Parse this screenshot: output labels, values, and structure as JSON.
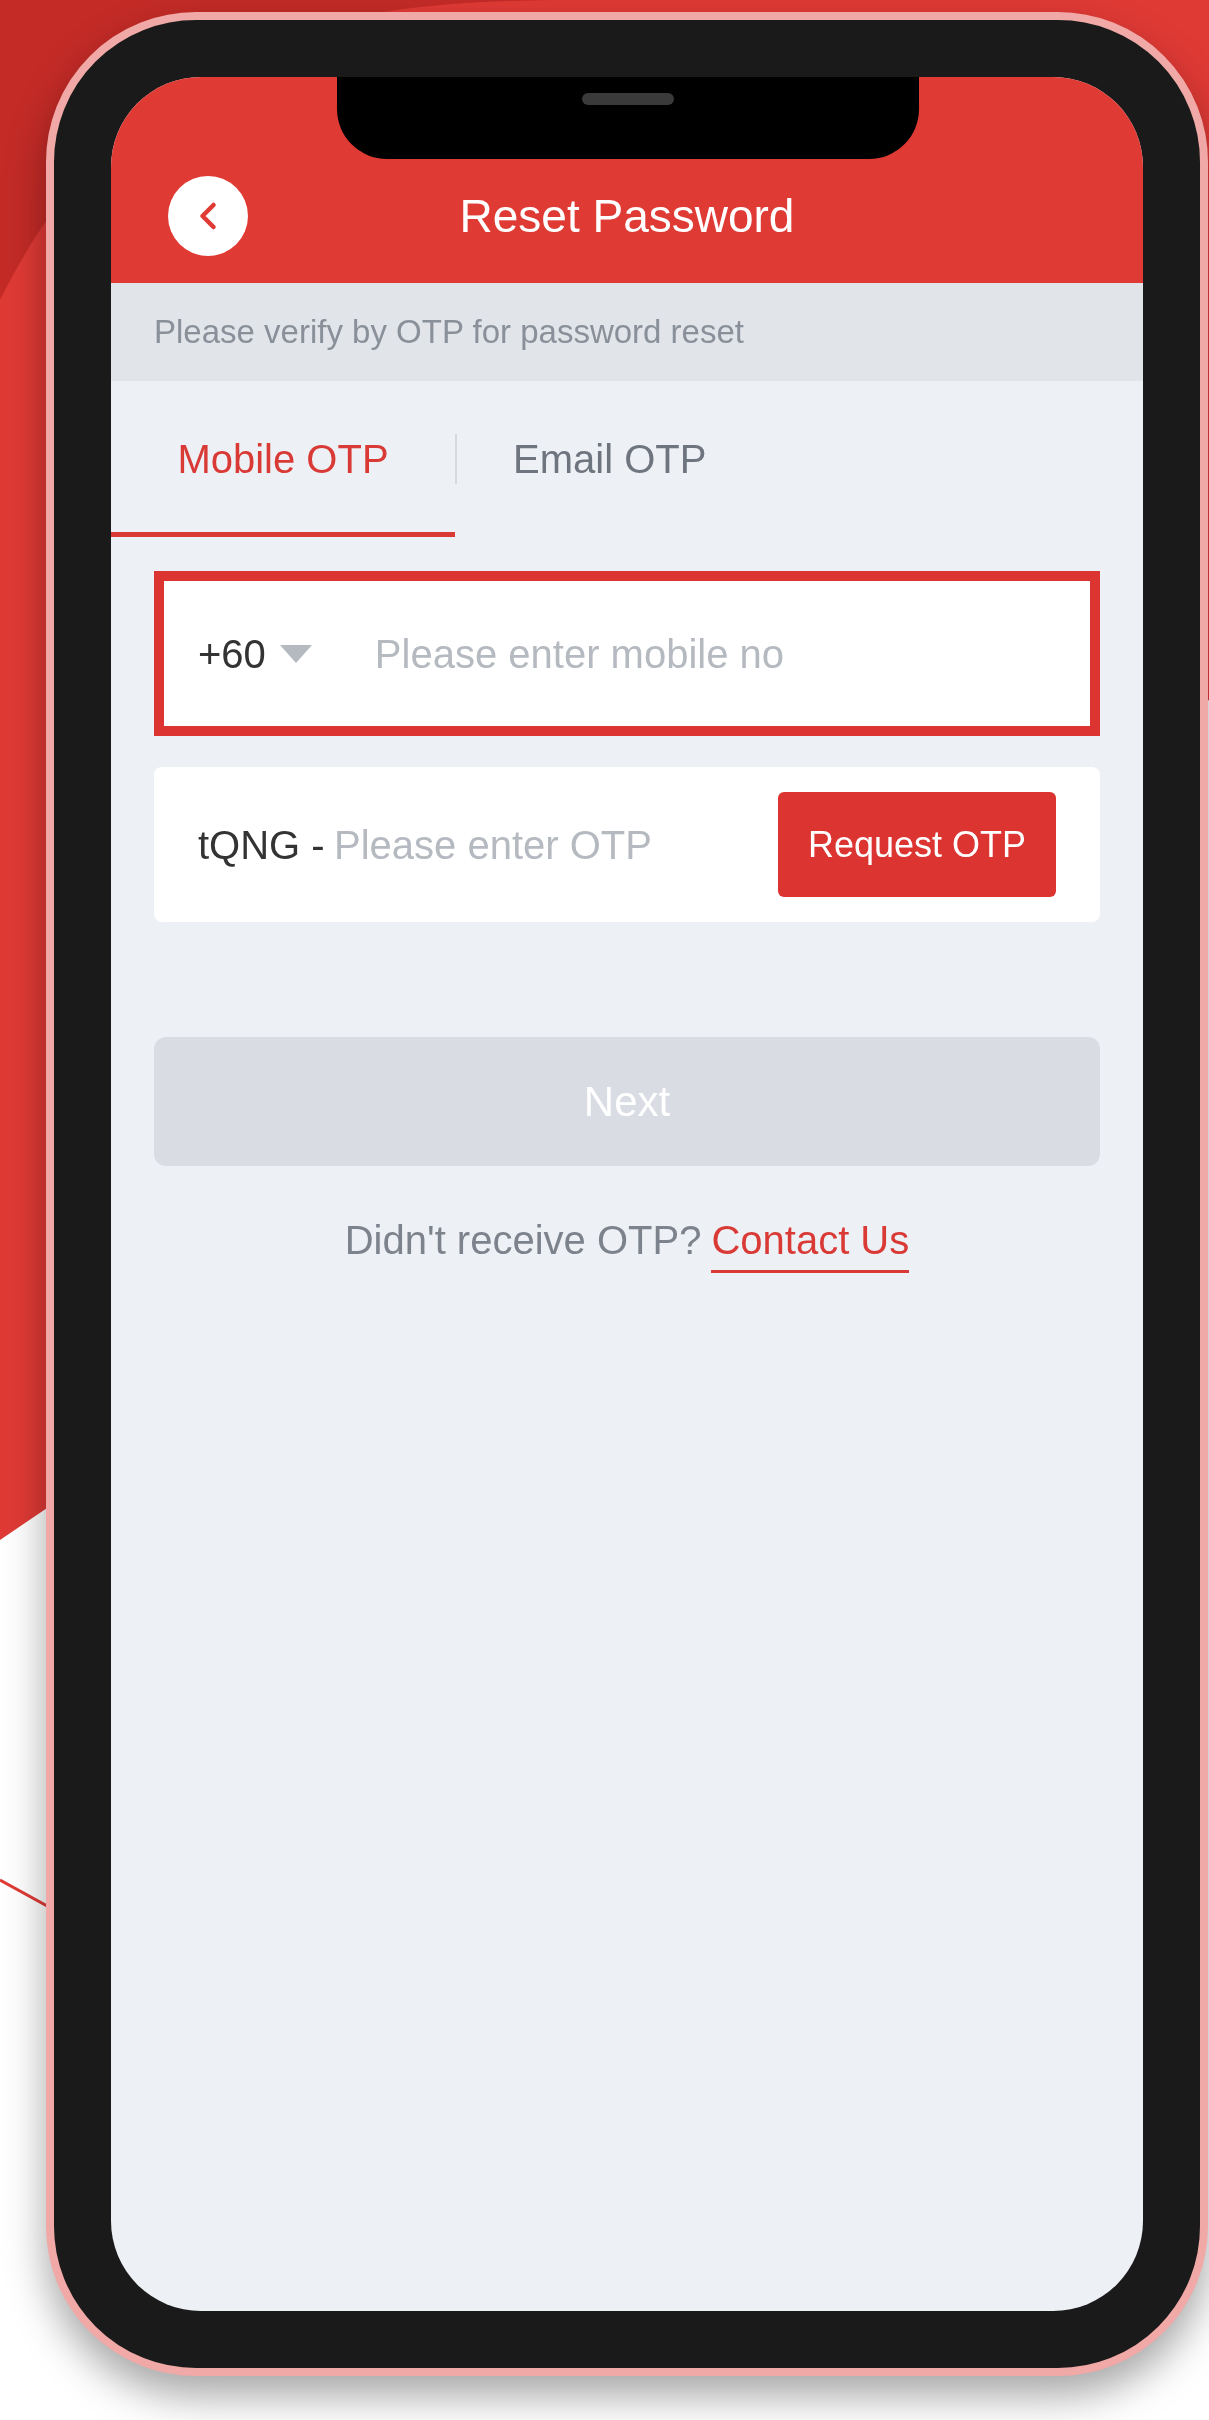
{
  "header": {
    "title": "Reset Password"
  },
  "notice": "Please verify by OTP for password reset",
  "tabs": [
    {
      "label": "Mobile OTP",
      "selected": true
    },
    {
      "label": "Email OTP",
      "selected": false
    }
  ],
  "mobile_field": {
    "country_code": "+60",
    "placeholder": "Please enter mobile no",
    "error": true
  },
  "otp_field": {
    "captcha": "tQNG -",
    "placeholder": "Please enter OTP",
    "button": "Request OTP"
  },
  "next_button": {
    "label": "Next",
    "disabled": true
  },
  "footer": {
    "text": "Didn't receive OTP?",
    "link": "Contact Us"
  }
}
